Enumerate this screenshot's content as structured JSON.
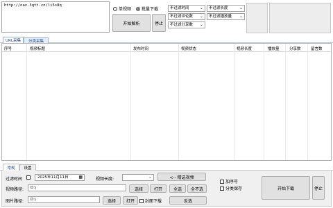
{
  "url_input": {
    "value": "http://nav.3qtt.cn/li5s8q"
  },
  "mode": {
    "single_label": "单视频",
    "batch_label": "批量下载",
    "selected": "batch"
  },
  "buttons": {
    "start_parse": "开始解析",
    "stop_top": "停止"
  },
  "filters": {
    "time": "不过滤时间",
    "length": "不过滤长度",
    "comments": "不过滤评论数",
    "plays": "不过滤播放量",
    "shares": "不过滤分享数"
  },
  "tabs_top": [
    "URL采集",
    "分类采集"
  ],
  "table": {
    "columns": [
      "序号",
      "视频标题",
      "发布时间",
      "视频状态",
      "视频长度",
      "播放量",
      "分享数",
      "留言数"
    ]
  },
  "tabs_bottom": [
    "常规",
    "设置"
  ],
  "form": {
    "filter_time_label": "过滤时间",
    "date_value": "2025年11月11日",
    "video_length_label": "视频长度:",
    "video_length_value": "",
    "select_video_button": "<-- 精选视频",
    "video_path_label": "视频路径:",
    "video_path_value": "D:\\",
    "image_path_label": "图片路径:",
    "image_path_value": "D:\\",
    "choose_button": "选择",
    "open_button": "打开",
    "select_all_button": "全选",
    "deselect_all_button": "全不选",
    "choose_button_2": "选择",
    "open_button_2": "打开",
    "cover_download_label": "封面下载",
    "invert_select_button": "反选",
    "add_serial_label": "加序号",
    "category_save_label": "分类保存",
    "start_download_button": "开始下载",
    "stop_bottom_button": "停止"
  }
}
